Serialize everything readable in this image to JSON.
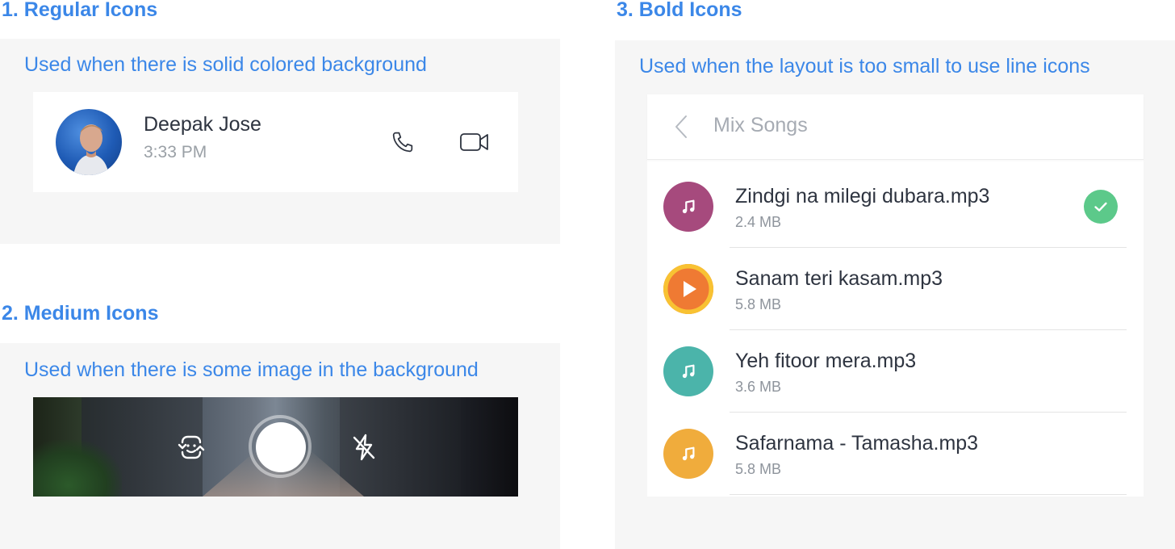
{
  "section1": {
    "heading": "1. Regular Icons",
    "subtitle": "Used when there is solid colored background",
    "contact": {
      "name": "Deepak Jose",
      "time": "3:33 PM"
    },
    "icons": [
      "phone-icon",
      "video-camera-icon"
    ]
  },
  "section2": {
    "heading": "2. Medium Icons",
    "subtitle": "Used when there is some image in the background",
    "icons": [
      "flip-camera-icon",
      "shutter-button",
      "flash-off-icon"
    ]
  },
  "section3": {
    "heading": "3. Bold Icons",
    "subtitle": "Used when the layout is too small to use line icons",
    "header_title": "Mix Songs",
    "songs": [
      {
        "title": "Zindgi na milegi dubara.mp3",
        "size": "2.4 MB",
        "color": "#a64a7d",
        "icon": "music-note-icon",
        "selected": true
      },
      {
        "title": "Sanam teri kasam.mp3",
        "size": "5.8 MB",
        "color": "#ef7a33",
        "icon": "play-icon",
        "playing": true
      },
      {
        "title": "Yeh fitoor mera.mp3",
        "size": "3.6 MB",
        "color": "#4bb4aa",
        "icon": "music-note-icon"
      },
      {
        "title": "Safarnama - Tamasha.mp3",
        "size": "5.8 MB",
        "color": "#f0ac3c",
        "icon": "music-note-icon"
      }
    ]
  },
  "colors": {
    "accent": "#3b87e8",
    "panel_bg": "#f6f6f6",
    "check_green": "#5cc98a",
    "progress_ring": "#f8c233"
  }
}
